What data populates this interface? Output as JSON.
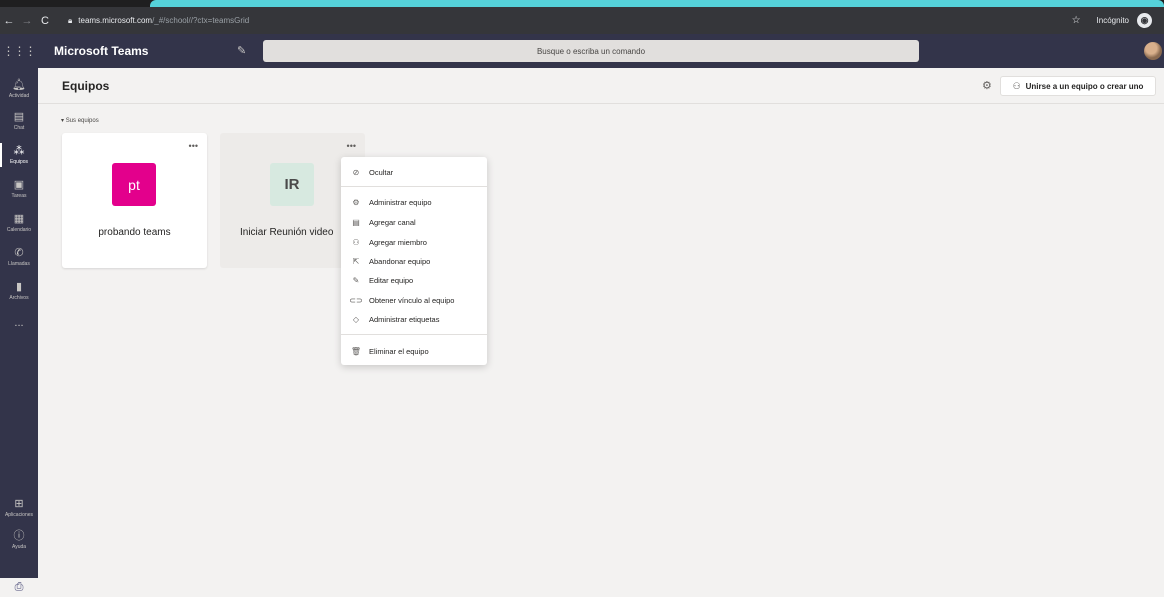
{
  "browser": {
    "url_host": "teams.microsoft.com",
    "url_path": "/_#/school//?ctx=teamsGrid",
    "incognito_label": "Incógnito"
  },
  "header": {
    "app_name": "Microsoft Teams",
    "search_placeholder": "Busque o escriba un comando"
  },
  "rail": {
    "items": [
      {
        "label": "Actividad",
        "icon": "bell-icon"
      },
      {
        "label": "Chat",
        "icon": "chat-icon"
      },
      {
        "label": "Equipos",
        "icon": "teams-icon",
        "active": true
      },
      {
        "label": "Tareas",
        "icon": "assignments-icon"
      },
      {
        "label": "Calendario",
        "icon": "calendar-icon"
      },
      {
        "label": "Llamadas",
        "icon": "phone-icon"
      },
      {
        "label": "Archivos",
        "icon": "files-icon"
      },
      {
        "label": "...",
        "icon": "more-icon"
      }
    ],
    "bottom_items": [
      {
        "label": "Aplicaciones",
        "icon": "apps-icon"
      },
      {
        "label": "Ayuda",
        "icon": "help-icon"
      }
    ]
  },
  "page": {
    "title": "Equipos",
    "join_button": "Unirse a un equipo o crear uno",
    "section_label": "Sus equipos"
  },
  "teams": [
    {
      "initials": "pt",
      "name": "probando teams",
      "color": "#e3008c"
    },
    {
      "initials": "IR",
      "name": "Iniciar Reunión video",
      "color": "#d7e9e0"
    }
  ],
  "context_menu": {
    "items": [
      {
        "label": "Ocultar",
        "icon": "hide-icon"
      },
      {
        "label": "Administrar equipo",
        "icon": "gear-icon"
      },
      {
        "label": "Agregar canal",
        "icon": "add-channel-icon"
      },
      {
        "label": "Agregar miembro",
        "icon": "add-member-icon"
      },
      {
        "label": "Abandonar equipo",
        "icon": "leave-icon"
      },
      {
        "label": "Editar equipo",
        "icon": "pencil-icon"
      },
      {
        "label": "Obtener vínculo al equipo",
        "icon": "link-icon"
      },
      {
        "label": "Administrar etiquetas",
        "icon": "tag-icon"
      },
      {
        "label": "Eliminar el equipo",
        "icon": "trash-icon"
      }
    ]
  }
}
